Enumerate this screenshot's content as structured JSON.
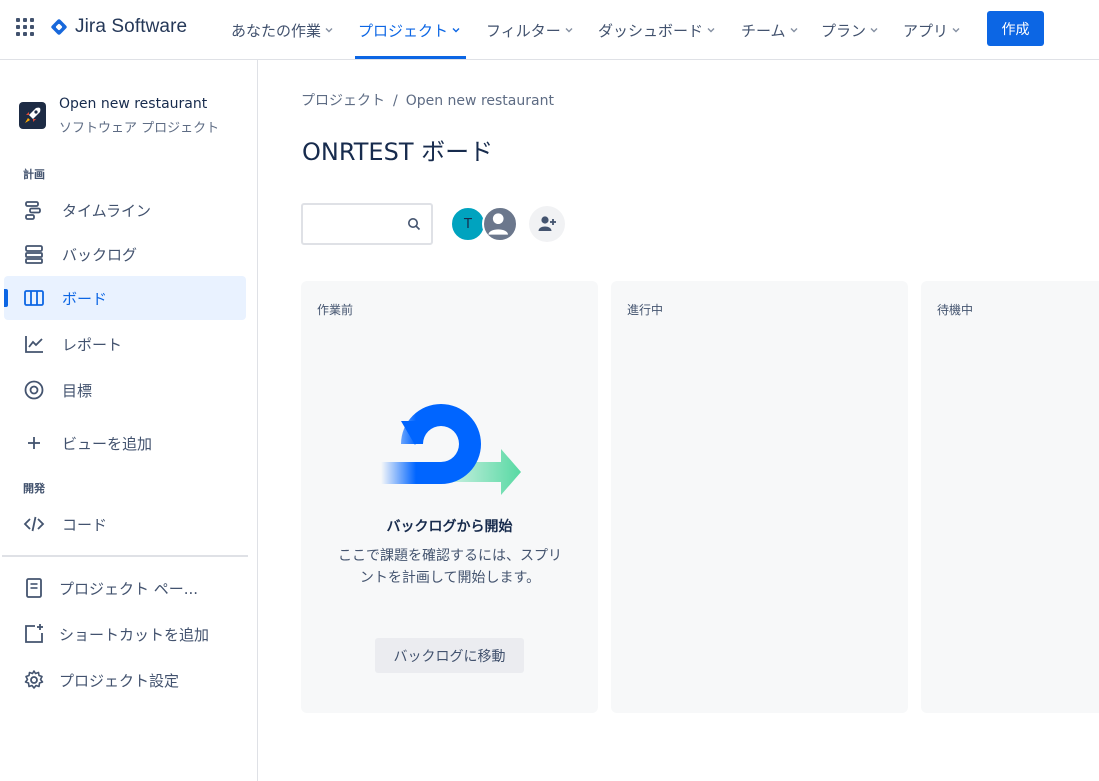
{
  "app": {
    "name": "Jira Software"
  },
  "nav": {
    "items": [
      {
        "label": "あなたの作業"
      },
      {
        "label": "プロジェクト"
      },
      {
        "label": "フィルター"
      },
      {
        "label": "ダッシュボード"
      },
      {
        "label": "チーム"
      },
      {
        "label": "プラン"
      },
      {
        "label": "アプリ"
      }
    ],
    "active": "プロジェクト",
    "create_label": "作成"
  },
  "sidebar": {
    "project_name": "Open new restaurant",
    "project_type": "ソフトウェア プロジェクト",
    "section_plan": "計画",
    "section_dev": "開発",
    "items": [
      {
        "label": "タイムライン",
        "icon": "timeline-icon"
      },
      {
        "label": "バックログ",
        "icon": "backlog-icon"
      },
      {
        "label": "ボード",
        "icon": "board-icon",
        "selected": true
      },
      {
        "label": "レポート",
        "icon": "reports-icon"
      },
      {
        "label": "目標",
        "icon": "goals-icon"
      },
      {
        "label": "ビューを追加",
        "icon": "plus-icon"
      },
      {
        "label": "コード",
        "icon": "code-icon"
      },
      {
        "label": "プロジェクト ペー...",
        "icon": "page-icon"
      },
      {
        "label": "ショートカットを追加",
        "icon": "add-shortcut-icon"
      },
      {
        "label": "プロジェクト設定",
        "icon": "gear-icon"
      }
    ]
  },
  "main": {
    "breadcrumb": [
      "プロジェクト",
      "Open new restaurant"
    ],
    "title": "ONRTEST ボード",
    "search": {
      "value": "",
      "placeholder": ""
    },
    "avatar_initial": "T",
    "columns": [
      {
        "title": "作業前"
      },
      {
        "title": "進行中"
      },
      {
        "title": "待機中"
      }
    ],
    "empty_state": {
      "title": "バックログから開始",
      "description": "ここで課題を確認するには、スプリントを計画して開始します。",
      "button": "バックログに移動"
    }
  },
  "colors": {
    "accent": "#0c66e4",
    "selected_bg": "#e9f2ff",
    "column_bg": "#f7f8f9"
  }
}
